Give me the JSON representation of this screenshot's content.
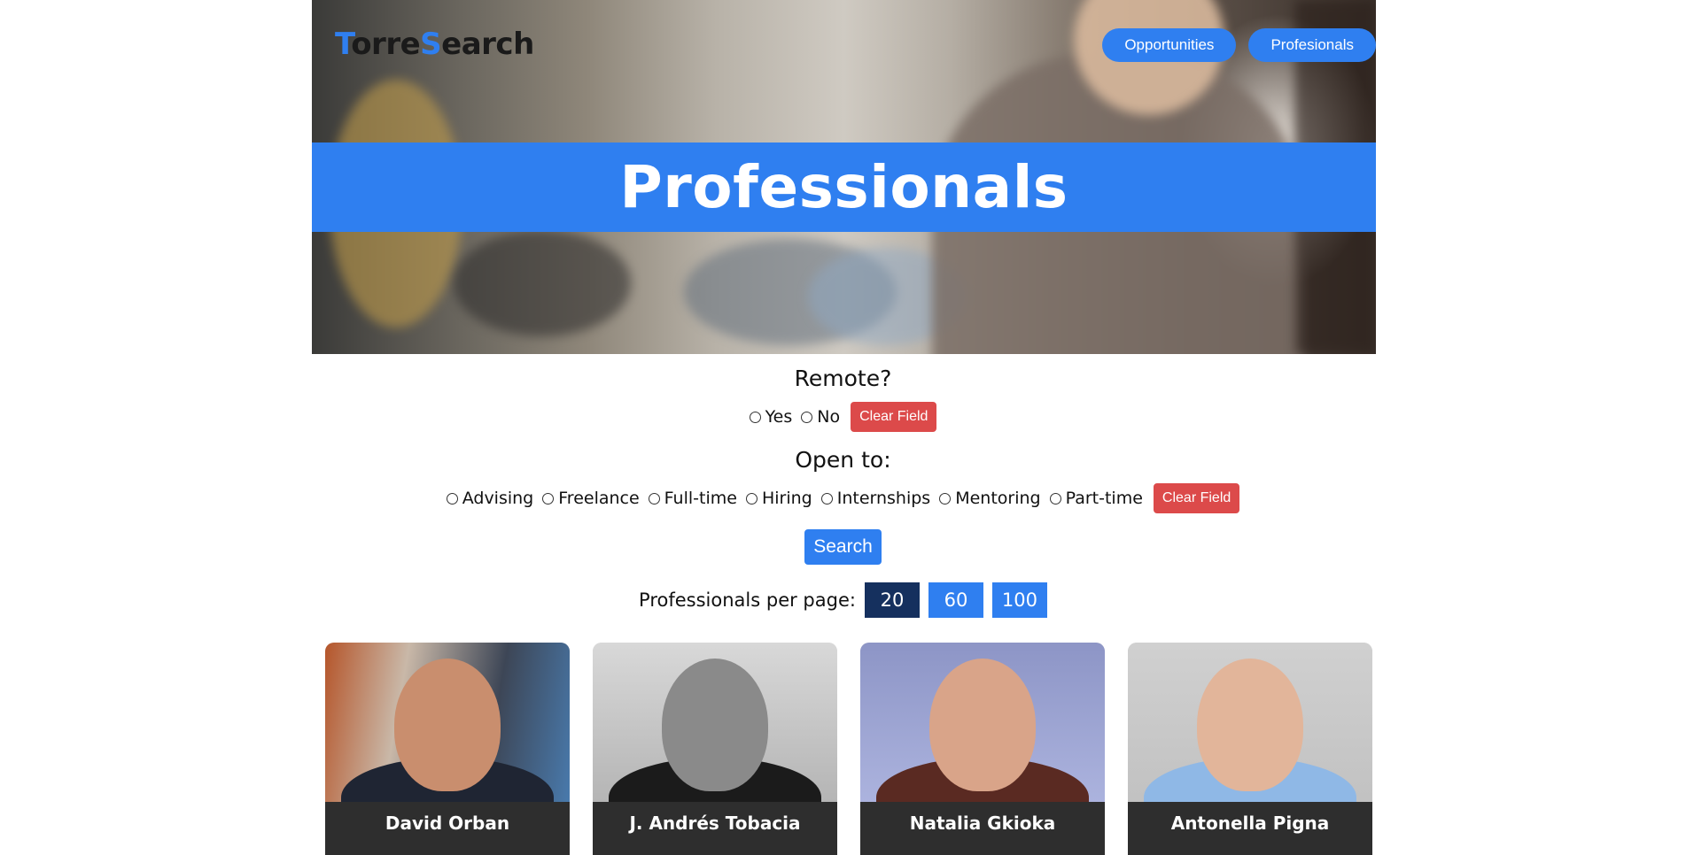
{
  "brand": {
    "first": "T",
    "middle": "orre",
    "second": "S",
    "rest": "earch"
  },
  "nav": {
    "opportunities": "Opportunities",
    "professionals": "Profesionals"
  },
  "hero": {
    "title": "Professionals"
  },
  "remote": {
    "title": "Remote?",
    "options": [
      "Yes",
      "No"
    ],
    "clear": "Clear Field"
  },
  "open_to": {
    "title": "Open to:",
    "options": [
      "Advising",
      "Freelance",
      "Full-time",
      "Hiring",
      "Internships",
      "Mentoring",
      "Part-time"
    ],
    "clear": "Clear Field"
  },
  "search_label": "Search",
  "per_page": {
    "label": "Professionals per page:",
    "options": [
      "20",
      "60",
      "100"
    ],
    "selected": "20"
  },
  "cards": [
    {
      "name": "David Orban"
    },
    {
      "name": "J. Andrés Tobacia"
    },
    {
      "name": "Natalia Gkioka"
    },
    {
      "name": "Antonella Pigna"
    }
  ],
  "colors": {
    "accent": "#2f7ff0",
    "danger": "#dc4a4a",
    "active_page": "#15305e",
    "nameplate": "#2e2e2e"
  }
}
